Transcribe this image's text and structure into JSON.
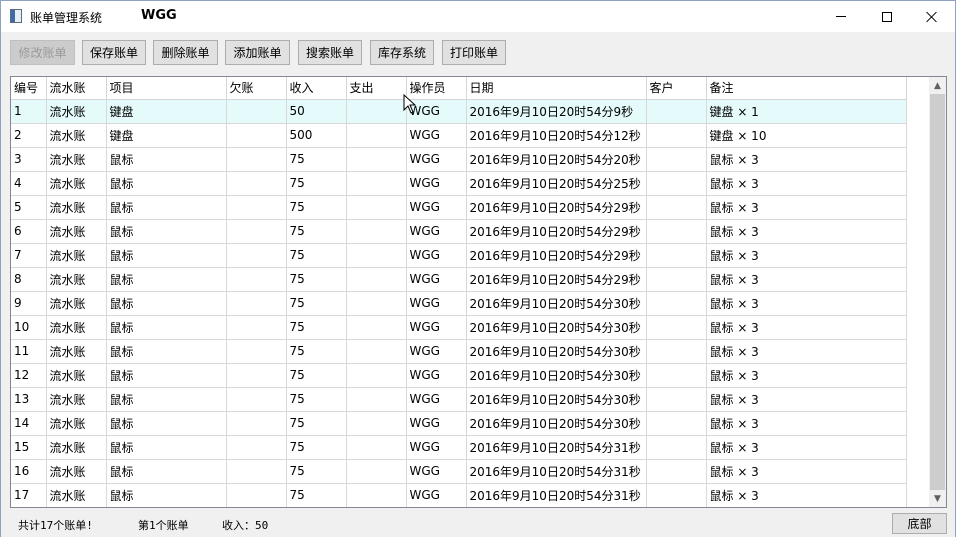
{
  "window": {
    "title": "账单管理系统",
    "user": "WGG"
  },
  "toolbar": {
    "buttons": [
      {
        "label": "修改账单",
        "enabled": false
      },
      {
        "label": "保存账单",
        "enabled": true
      },
      {
        "label": "删除账单",
        "enabled": true
      },
      {
        "label": "添加账单",
        "enabled": true
      },
      {
        "label": "搜索账单",
        "enabled": true
      },
      {
        "label": "库存系统",
        "enabled": true
      },
      {
        "label": "打印账单",
        "enabled": true
      }
    ]
  },
  "table": {
    "columns": [
      "编号",
      "流水账",
      "项目",
      "欠账",
      "收入",
      "支出",
      "操作员",
      "日期",
      "客户",
      "备注"
    ],
    "selected_row": 0,
    "rows": [
      [
        "1",
        "流水账",
        "键盘",
        "",
        "50",
        "",
        "WGG",
        "2016年9月10日20时54分9秒",
        "",
        "键盘 × 1"
      ],
      [
        "2",
        "流水账",
        "键盘",
        "",
        "500",
        "",
        "WGG",
        "2016年9月10日20时54分12秒",
        "",
        "键盘 × 10"
      ],
      [
        "3",
        "流水账",
        "鼠标",
        "",
        "75",
        "",
        "WGG",
        "2016年9月10日20时54分20秒",
        "",
        "鼠标 × 3"
      ],
      [
        "4",
        "流水账",
        "鼠标",
        "",
        "75",
        "",
        "WGG",
        "2016年9月10日20时54分25秒",
        "",
        "鼠标 × 3"
      ],
      [
        "5",
        "流水账",
        "鼠标",
        "",
        "75",
        "",
        "WGG",
        "2016年9月10日20时54分29秒",
        "",
        "鼠标 × 3"
      ],
      [
        "6",
        "流水账",
        "鼠标",
        "",
        "75",
        "",
        "WGG",
        "2016年9月10日20时54分29秒",
        "",
        "鼠标 × 3"
      ],
      [
        "7",
        "流水账",
        "鼠标",
        "",
        "75",
        "",
        "WGG",
        "2016年9月10日20时54分29秒",
        "",
        "鼠标 × 3"
      ],
      [
        "8",
        "流水账",
        "鼠标",
        "",
        "75",
        "",
        "WGG",
        "2016年9月10日20时54分29秒",
        "",
        "鼠标 × 3"
      ],
      [
        "9",
        "流水账",
        "鼠标",
        "",
        "75",
        "",
        "WGG",
        "2016年9月10日20时54分30秒",
        "",
        "鼠标 × 3"
      ],
      [
        "10",
        "流水账",
        "鼠标",
        "",
        "75",
        "",
        "WGG",
        "2016年9月10日20时54分30秒",
        "",
        "鼠标 × 3"
      ],
      [
        "11",
        "流水账",
        "鼠标",
        "",
        "75",
        "",
        "WGG",
        "2016年9月10日20时54分30秒",
        "",
        "鼠标 × 3"
      ],
      [
        "12",
        "流水账",
        "鼠标",
        "",
        "75",
        "",
        "WGG",
        "2016年9月10日20时54分30秒",
        "",
        "鼠标 × 3"
      ],
      [
        "13",
        "流水账",
        "鼠标",
        "",
        "75",
        "",
        "WGG",
        "2016年9月10日20时54分30秒",
        "",
        "鼠标 × 3"
      ],
      [
        "14",
        "流水账",
        "鼠标",
        "",
        "75",
        "",
        "WGG",
        "2016年9月10日20时54分30秒",
        "",
        "鼠标 × 3"
      ],
      [
        "15",
        "流水账",
        "鼠标",
        "",
        "75",
        "",
        "WGG",
        "2016年9月10日20时54分31秒",
        "",
        "鼠标 × 3"
      ],
      [
        "16",
        "流水账",
        "鼠标",
        "",
        "75",
        "",
        "WGG",
        "2016年9月10日20时54分31秒",
        "",
        "鼠标 × 3"
      ],
      [
        "17",
        "流水账",
        "鼠标",
        "",
        "75",
        "",
        "WGG",
        "2016年9月10日20时54分31秒",
        "",
        "鼠标 × 3"
      ]
    ]
  },
  "status": {
    "total": "共计17个账单!",
    "current": "第1个账单",
    "income": "收入：50",
    "bottom_button": "底部"
  },
  "icons": {
    "app": "ledger-app-icon",
    "minimize": "minimize-icon",
    "maximize": "maximize-icon",
    "close": "close-icon",
    "scroll_up": "scroll-up-arrow-icon",
    "scroll_down": "scroll-down-arrow-icon",
    "cursor": "mouse-pointer-icon"
  },
  "colors": {
    "selected_row": "#e5fbfb",
    "window_bg": "#f0f0f0",
    "button_bg": "#e1e1e1",
    "disabled_text": "#9b9b9b"
  }
}
